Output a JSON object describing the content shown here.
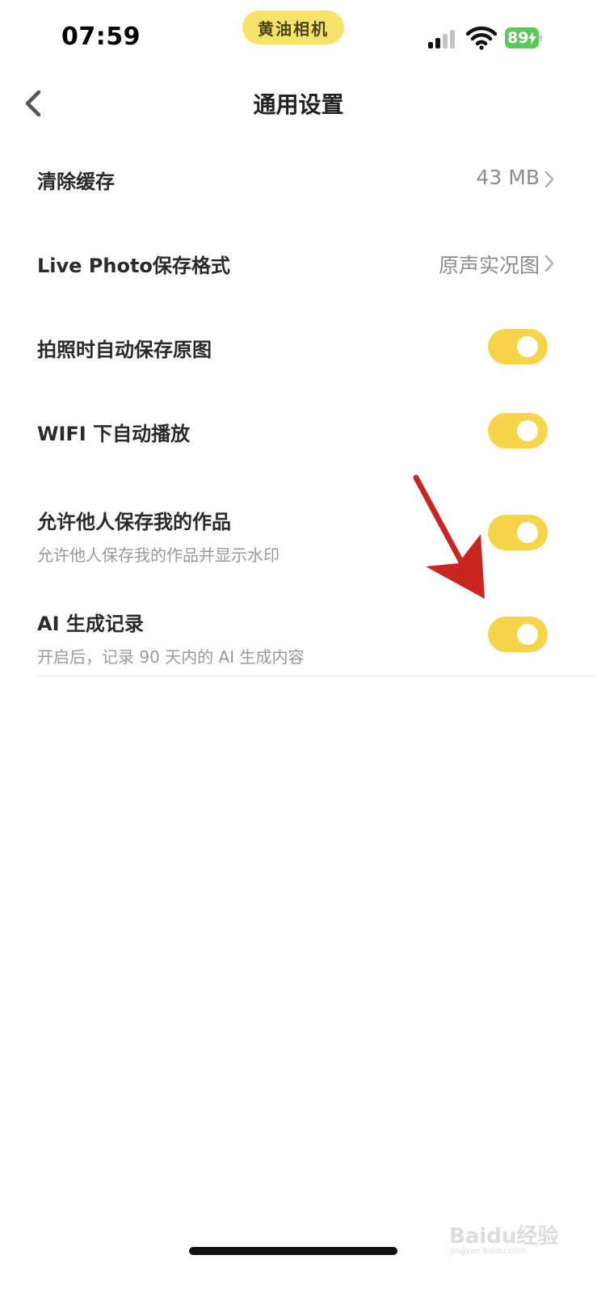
{
  "status_bar": {
    "time": "07:59",
    "app_name": "黄油相机",
    "battery_level": "89",
    "battery_color": "#5cc85c",
    "pill_color": "#f8e36a"
  },
  "nav": {
    "title": "通用设置",
    "back_icon": "chevron-left-icon"
  },
  "settings": {
    "clear_cache": {
      "label": "清除缓存",
      "value": "43 MB"
    },
    "live_photo_format": {
      "label": "Live Photo保存格式",
      "value": "原声实况图"
    },
    "auto_save_original": {
      "label": "拍照时自动保存原图",
      "enabled": true
    },
    "wifi_autoplay": {
      "label": "WIFI 下自动播放",
      "enabled": true
    },
    "allow_save_works": {
      "label": "允许他人保存我的作品",
      "description": "允许他人保存我的作品并显示水印",
      "enabled": true
    },
    "ai_history": {
      "label": "AI 生成记录",
      "description": "开启后，记录 90 天内的 AI 生成内容",
      "enabled": true
    }
  },
  "annotation": {
    "arrow_color": "#c8261f"
  },
  "colors": {
    "accent": "#f7d54a",
    "text_primary": "#2a2a2a",
    "text_secondary": "#9a9a9a"
  },
  "watermark": {
    "text": "Baidu经验",
    "subtext": "jingyan.baidu.com"
  }
}
